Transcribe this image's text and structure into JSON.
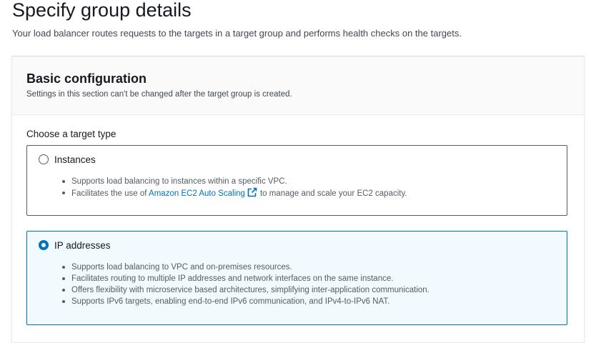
{
  "page": {
    "title": "Specify group details",
    "description": "Your load balancer routes requests to the targets in a target group and performs health checks on the targets."
  },
  "basic_config": {
    "title": "Basic configuration",
    "description": "Settings in this section can't be changed after the target group is created.",
    "target_type_label": "Choose a target type",
    "options": [
      {
        "label": "Instances",
        "selected": false,
        "bullets": [
          "Supports load balancing to instances within a specific VPC."
        ],
        "bullet2_prefix": "Facilitates the use of",
        "bullet2_link": "Amazon EC2 Auto Scaling",
        "bullet2_suffix": "to manage and scale your EC2 capacity."
      },
      {
        "label": "IP addresses",
        "selected": true,
        "bullets": [
          "Supports load balancing to VPC and on-premises resources.",
          "Facilitates routing to multiple IP addresses and network interfaces on the same instance.",
          "Offers flexibility with microservice based architectures, simplifying inter-application communication.",
          "Supports IPv6 targets, enabling end-to-end IPv6 communication, and IPv4-to-IPv6 NAT."
        ]
      }
    ]
  },
  "icons": {
    "external_link": "external-link-icon"
  },
  "colors": {
    "accent": "#0073bb",
    "selected_bg": "#f1faff"
  }
}
